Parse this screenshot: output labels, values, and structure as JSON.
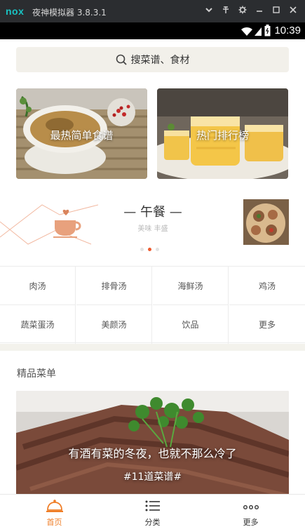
{
  "window": {
    "logo": "nox",
    "title": "夜神模拟器 3.8.3.1"
  },
  "status": {
    "time": "10:39"
  },
  "search": {
    "label": "搜菜谱、食材"
  },
  "cards": [
    {
      "label": "最热简单食谱"
    },
    {
      "label": "热门排行榜"
    }
  ],
  "meal": {
    "title": "— 午餐 —",
    "subtitle": "美味 丰盛"
  },
  "categories": [
    "肉汤",
    "排骨汤",
    "海鲜汤",
    "鸡汤",
    "蔬菜蛋汤",
    "美颜汤",
    "饮品",
    "更多"
  ],
  "featured": {
    "title": "精品菜单",
    "banner_title": "有酒有菜的冬夜，也就不那么冷了",
    "banner_sub": "#11道菜谱#"
  },
  "tabs": [
    {
      "label": "首页",
      "icon": "cloche-icon",
      "active": true
    },
    {
      "label": "分类",
      "icon": "list-icon",
      "active": false
    },
    {
      "label": "更多",
      "icon": "more-dots-icon",
      "active": false
    }
  ],
  "colors": {
    "accent": "#ef7d26",
    "dot_active": "#ec5a2e",
    "search_bg": "#f2f0ea"
  }
}
